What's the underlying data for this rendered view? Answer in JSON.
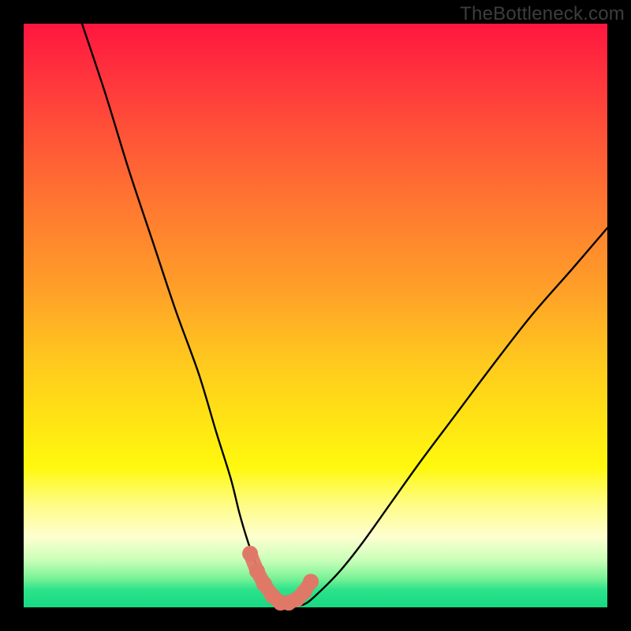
{
  "watermark": "TheBottleneck.com",
  "chart_data": {
    "type": "line",
    "title": "",
    "xlabel": "",
    "ylabel": "",
    "xlim": [
      0,
      100
    ],
    "ylim": [
      0,
      100
    ],
    "series": [
      {
        "name": "bottleneck-curve",
        "x": [
          10,
          14,
          18,
          22,
          26,
          30,
          33,
          35.5,
          37,
          38.5,
          40,
          41.5,
          43,
          44.5,
          46,
          48,
          50,
          54,
          58,
          63,
          68,
          74,
          80,
          87,
          94,
          100
        ],
        "values": [
          100,
          88,
          75,
          63,
          51,
          40,
          30,
          22,
          16,
          11,
          7,
          4,
          1.5,
          0.4,
          0.3,
          0.5,
          2,
          6,
          11,
          18,
          25,
          33,
          41,
          50,
          58,
          65
        ]
      },
      {
        "name": "valley-marker",
        "x": [
          38.8,
          40,
          41.2,
          42.6,
          44,
          45.4,
          46.8,
          48,
          49.2
        ],
        "values": [
          9.2,
          6.2,
          4.0,
          2.0,
          0.8,
          0.8,
          1.4,
          2.6,
          4.4
        ]
      }
    ],
    "annotations": [],
    "grid": false,
    "legend": false,
    "background_gradient": {
      "top": "#ff163e",
      "mid_upper": "#ff7a30",
      "mid": "#ffe414",
      "mid_lower": "#fdffd0",
      "bottom": "#17d982"
    },
    "marker_color": "#e07868",
    "curve_color": "#000000"
  }
}
